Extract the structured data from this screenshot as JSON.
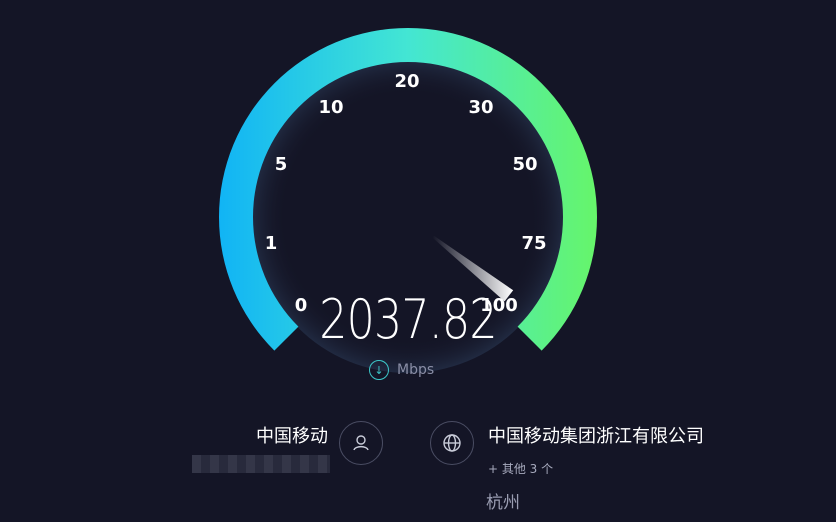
{
  "gauge": {
    "ticks": [
      "0",
      "1",
      "5",
      "10",
      "20",
      "30",
      "50",
      "75",
      "100"
    ],
    "needle_value_label": "100"
  },
  "result": {
    "speed": "2037.82",
    "unit": "Mbps",
    "direction_icon": "download-arrow-icon"
  },
  "isp": {
    "name": "中国移动",
    "icon": "user-icon"
  },
  "server": {
    "name": "中国移动集团浙江有限公司",
    "more": "+ 其他 3 个",
    "city": "杭州",
    "icon": "globe-icon"
  },
  "colors": {
    "background": "#141526",
    "gauge_start": "#11b4f5",
    "gauge_mid": "#43e6d3",
    "gauge_end": "#66f56a"
  }
}
